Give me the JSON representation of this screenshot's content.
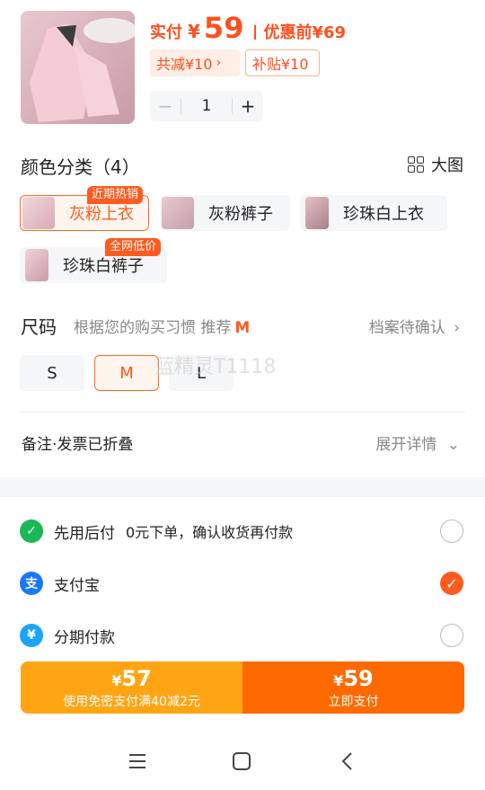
{
  "header": {
    "paid_label": "实付",
    "currency": "¥",
    "paid_amount": "59",
    "before_discount": "优惠前¥69",
    "total_discount": "共减¥10",
    "subsidy": "补贴¥10"
  },
  "quantity": {
    "minus": "−",
    "value": "1",
    "plus": "+"
  },
  "color_section": {
    "title": "颜色分类（4）",
    "big_picture": "大图",
    "options": [
      {
        "label": "灰粉上衣",
        "badge": "近期热销",
        "selected": true
      },
      {
        "label": "灰粉裤子",
        "badge": "",
        "selected": false
      },
      {
        "label": "珍珠白上衣",
        "badge": "",
        "selected": false
      },
      {
        "label": "珍珠白裤子",
        "badge": "全网低价",
        "selected": false
      }
    ]
  },
  "size_section": {
    "title": "尺码",
    "hint": "根据您的购买习惯 推荐",
    "recommended": "M",
    "archive": "档案待确认",
    "sizes": [
      "S",
      "M",
      "L"
    ],
    "selected": "M"
  },
  "watermark": "蓝精灵T1118",
  "remark": {
    "label": "备注·发票已折叠",
    "expand": "展开详情"
  },
  "payment_methods": [
    {
      "icon": "bnpl-icon",
      "name": "先用后付",
      "desc": "0元下单，确认收货再付款",
      "checked": false,
      "color": "#19b955"
    },
    {
      "icon": "alipay-icon",
      "name": "支付宝",
      "desc": "",
      "checked": true,
      "color": "#1677ff"
    },
    {
      "icon": "installment-icon",
      "name": "分期付款",
      "desc": "",
      "checked": false,
      "color": "#1aa3ff"
    }
  ],
  "pay_bar": {
    "left_amount": "57",
    "left_sub": "使用免密支付满40减2元",
    "right_amount": "59",
    "right_sub": "立即支付",
    "symbol": "¥"
  },
  "colors": {
    "accent": "#ff5a1f",
    "left_button": "#ffa514",
    "right_button": "#ff6a00"
  }
}
